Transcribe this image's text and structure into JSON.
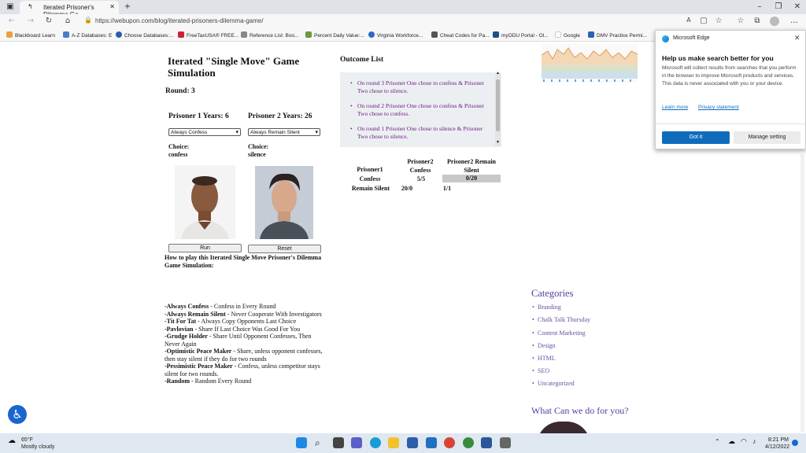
{
  "browser": {
    "tab_title": "Iterated Prisoner's Dilemma Ga...",
    "url": "https://webupon.com/blog/iterated-prisoners-dilemma-game/",
    "bookmarks": [
      "Blackboard Learn",
      "A-Z Databases: E",
      "Choose Databases:...",
      "FreeTaxUSA® FREE...",
      "Reference List: Boo...",
      "Percent Daily Value:...",
      "Virginia Workforce...",
      "Cheat Codes for Pa...",
      "myODU Portal - Ol...",
      "Google",
      "DMV Practice Permi..."
    ]
  },
  "game": {
    "title": "Iterated \"Single Move\" Game Simulation",
    "round": "Round: 3",
    "p1_years": "Prisoner 1 Years: 6",
    "p2_years": "Prisoner 2 Years: 26",
    "p1_strategy": "Always Confess",
    "p2_strategy": "Always Remain Silent",
    "p1_choice_label": "Choice:",
    "p1_choice": "confess",
    "p2_choice_label": "Choice:",
    "p2_choice": "silence",
    "run_label": "Run",
    "reset_label": "Reset",
    "howto_title": "How to play this Iterated Single Move Prisoner's Dilemma Game Simulation:",
    "strategies": [
      {
        "name": "-Always Confess",
        "desc": " - Confess in Every Round"
      },
      {
        "name": "-Always Remain Silent",
        "desc": " - Never Cooperate With Investigators"
      },
      {
        "name": "-Tit For Tat",
        "desc": " - Always Copy Opponents Last Choice"
      },
      {
        "name": "-Pavlovian",
        "desc": " - Share If Last Choice Was Good For You"
      },
      {
        "name": "-Grudge Holder",
        "desc": " - Share Until Opponent Confesses, Then Never Again"
      },
      {
        "name": "-Optimistic Peace Maker",
        "desc": " - Share, unless opponent confesses, then stay silent if they do for two rounds"
      },
      {
        "name": "-Pessimistic Peace Maker",
        "desc": " - Confess, unless competitor stays silent for two rounds."
      },
      {
        "name": "-Random",
        "desc": " - Random Every Round"
      }
    ]
  },
  "outcome": {
    "title": "Outcome List",
    "items": [
      "On round 3 Prisoner One chose to confess & Prisoner Two chose to silence.",
      "On round 2 Prisoner One chose to confess & Prisoner Two chose to confess.",
      "On round 1 Prisoner One chose to silence & Prisoner Two chose to silence."
    ]
  },
  "matrix": {
    "col1_header": "Prisoner2 Confess",
    "col2_header": "Prisoner2 Remain Silent",
    "row_header": "Prisoner1",
    "row1_label": "Confess",
    "row2_label": "Remain Silent",
    "c11": "5/5",
    "c12": "0/20",
    "c21": "20/0",
    "c22": "1/1"
  },
  "sidebar": {
    "categories_title": "Categories",
    "categories": [
      "Branding",
      "Chalk Talk Thursday",
      "Content Marketing",
      "Design",
      "HTML",
      "SEO",
      "Uncategorized"
    ],
    "help_title": "What Can we do for you?"
  },
  "popup": {
    "brand": "Microsoft Edge",
    "heading": "Help us make search better for you",
    "body": "Microsoft will collect results from searches that you perform in the browser to improve Microsoft products and services. This data is never associated with you or your device.",
    "learn_more": "Learn more",
    "privacy": "Privacy statement",
    "got_it": "Got it",
    "manage": "Manage setting"
  },
  "taskbar": {
    "temp": "65°F",
    "weather": "Mostly cloudy",
    "time": "8:21 PM",
    "date": "4/12/2022"
  },
  "colors": {
    "accent": "#0f6cbd",
    "outcome_text": "#6b1d86",
    "category": "#6b4fa0"
  }
}
